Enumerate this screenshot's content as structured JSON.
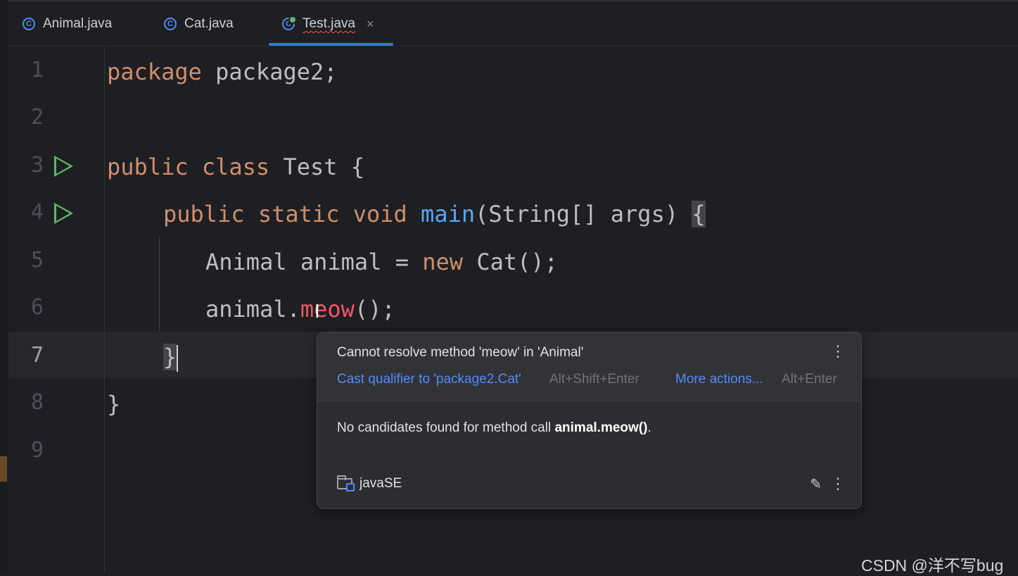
{
  "tabs": [
    {
      "label": "Animal.java",
      "icon": "class-icon",
      "active": false
    },
    {
      "label": "Cat.java",
      "icon": "class-icon",
      "active": false
    },
    {
      "label": "Test.java",
      "icon": "runnable-class-icon",
      "active": true,
      "close": "×"
    }
  ],
  "editor": {
    "line_numbers": [
      "1",
      "2",
      "3",
      "4",
      "5",
      "6",
      "7",
      "8",
      "9"
    ],
    "current_line": "7",
    "lines": {
      "l1": {
        "kw": "package",
        "rest": " package2;"
      },
      "l3": {
        "kw1": "public",
        "kw2": "class",
        "rest": " Test {"
      },
      "l4": {
        "kw1": "public",
        "kw2": "static",
        "kw3": "void",
        "fn": "main",
        "rest": "(String[] args) ",
        "brace": "{"
      },
      "l5": {
        "pre": "Animal animal = ",
        "kw": "new",
        "rest": " Cat();"
      },
      "l6": {
        "pre": "animal.",
        "err": "meow",
        "rest": "();"
      },
      "l7": {
        "brace": "}"
      },
      "l8": {
        "text": "}"
      }
    },
    "text_cursor_glyph": "I"
  },
  "popup": {
    "title": "Cannot resolve method 'meow' in 'Animal'",
    "more_glyph": "⋮",
    "quickfix_label": "Cast qualifier to 'package2.Cat'",
    "quickfix_shortcut": "Alt+Shift+Enter",
    "more_actions_label": "More actions...",
    "more_actions_shortcut": "Alt+Enter",
    "description_prefix": "No candidates found for method call ",
    "description_bold": "animal.meow()",
    "description_suffix": ".",
    "module": "javaSE",
    "pencil_glyph": "✎"
  },
  "watermark": "CSDN @洋不写bug",
  "colors": {
    "keyword": "#cf8e6d",
    "function": "#56a8f5",
    "error": "#f75464",
    "link": "#548af7",
    "run": "#5fb865",
    "accent": "#3574f0"
  }
}
